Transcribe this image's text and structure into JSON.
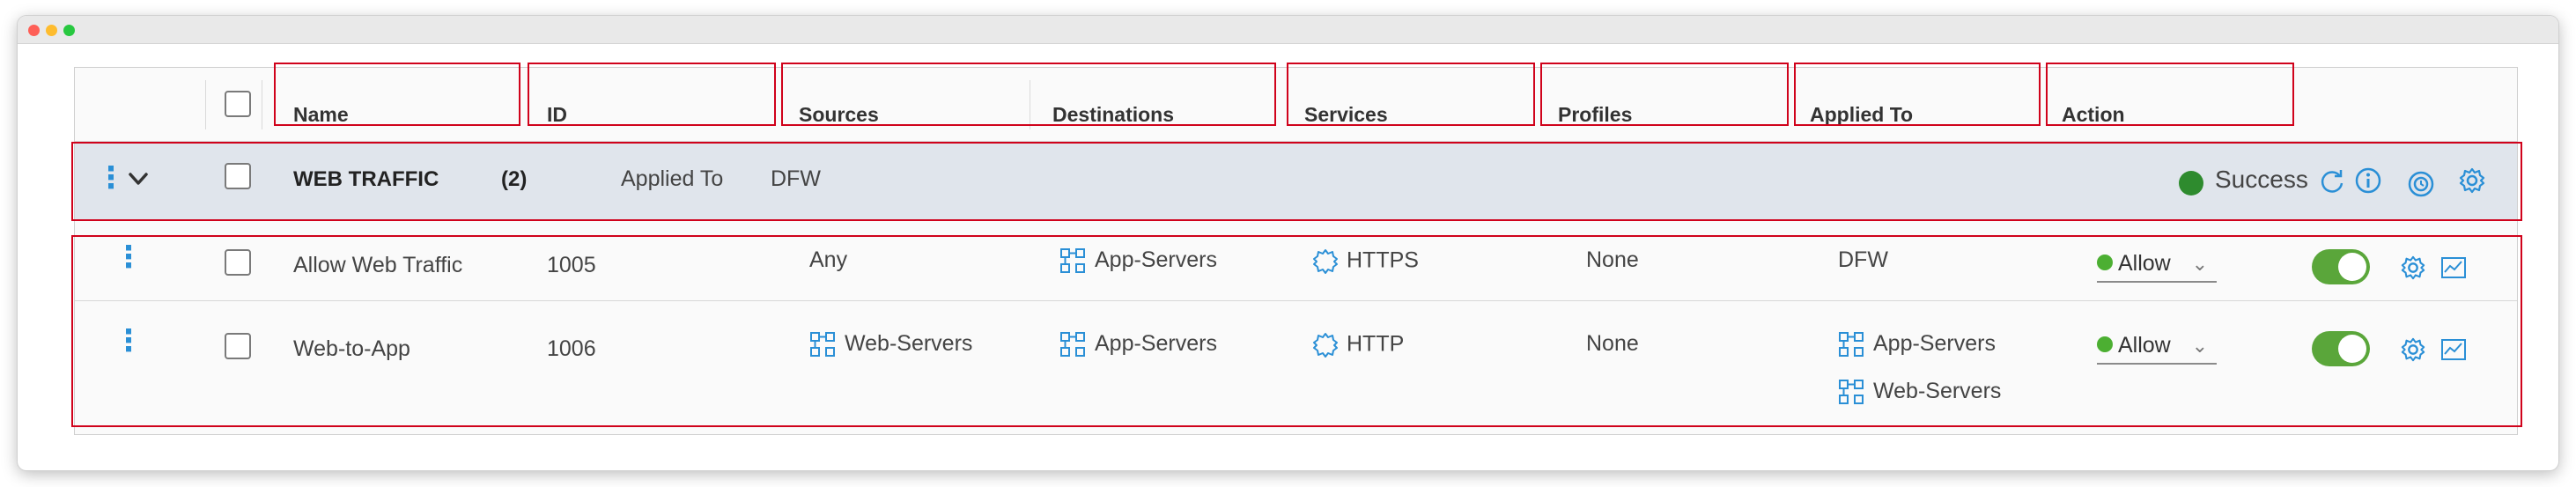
{
  "window": {
    "buttons": [
      "close",
      "minimize",
      "zoom"
    ]
  },
  "columns": {
    "name": "Name",
    "id": "ID",
    "sources": "Sources",
    "destinations": "Destinations",
    "services": "Services",
    "profiles": "Profiles",
    "applied_to": "Applied To",
    "action": "Action"
  },
  "section": {
    "name": "WEB TRAFFIC",
    "count": "(2)",
    "applied_to_label": "Applied To",
    "applied_to_value": "DFW",
    "status": "Success",
    "status_color": "#2e8b2e",
    "icons": [
      "refresh-icon",
      "info-icon",
      "history-icon",
      "gear-icon"
    ]
  },
  "rules": [
    {
      "name": "Allow Web Traffic",
      "id": "1005",
      "sources": [
        "Any"
      ],
      "destinations": [
        "App-Servers"
      ],
      "services": [
        "HTTPS"
      ],
      "profiles": "None",
      "applied_to": [
        "DFW"
      ],
      "action": "Allow",
      "enabled": true
    },
    {
      "name": "Web-to-App",
      "id": "1006",
      "sources": [
        "Web-Servers"
      ],
      "destinations": [
        "App-Servers"
      ],
      "services": [
        "HTTP"
      ],
      "profiles": "None",
      "applied_to": [
        "App-Servers",
        "Web-Servers"
      ],
      "action": "Allow",
      "enabled": true
    }
  ],
  "colors": {
    "accent": "#2a8fd6",
    "highlight": "#d0021b",
    "toggle_on": "#5aa63a"
  }
}
